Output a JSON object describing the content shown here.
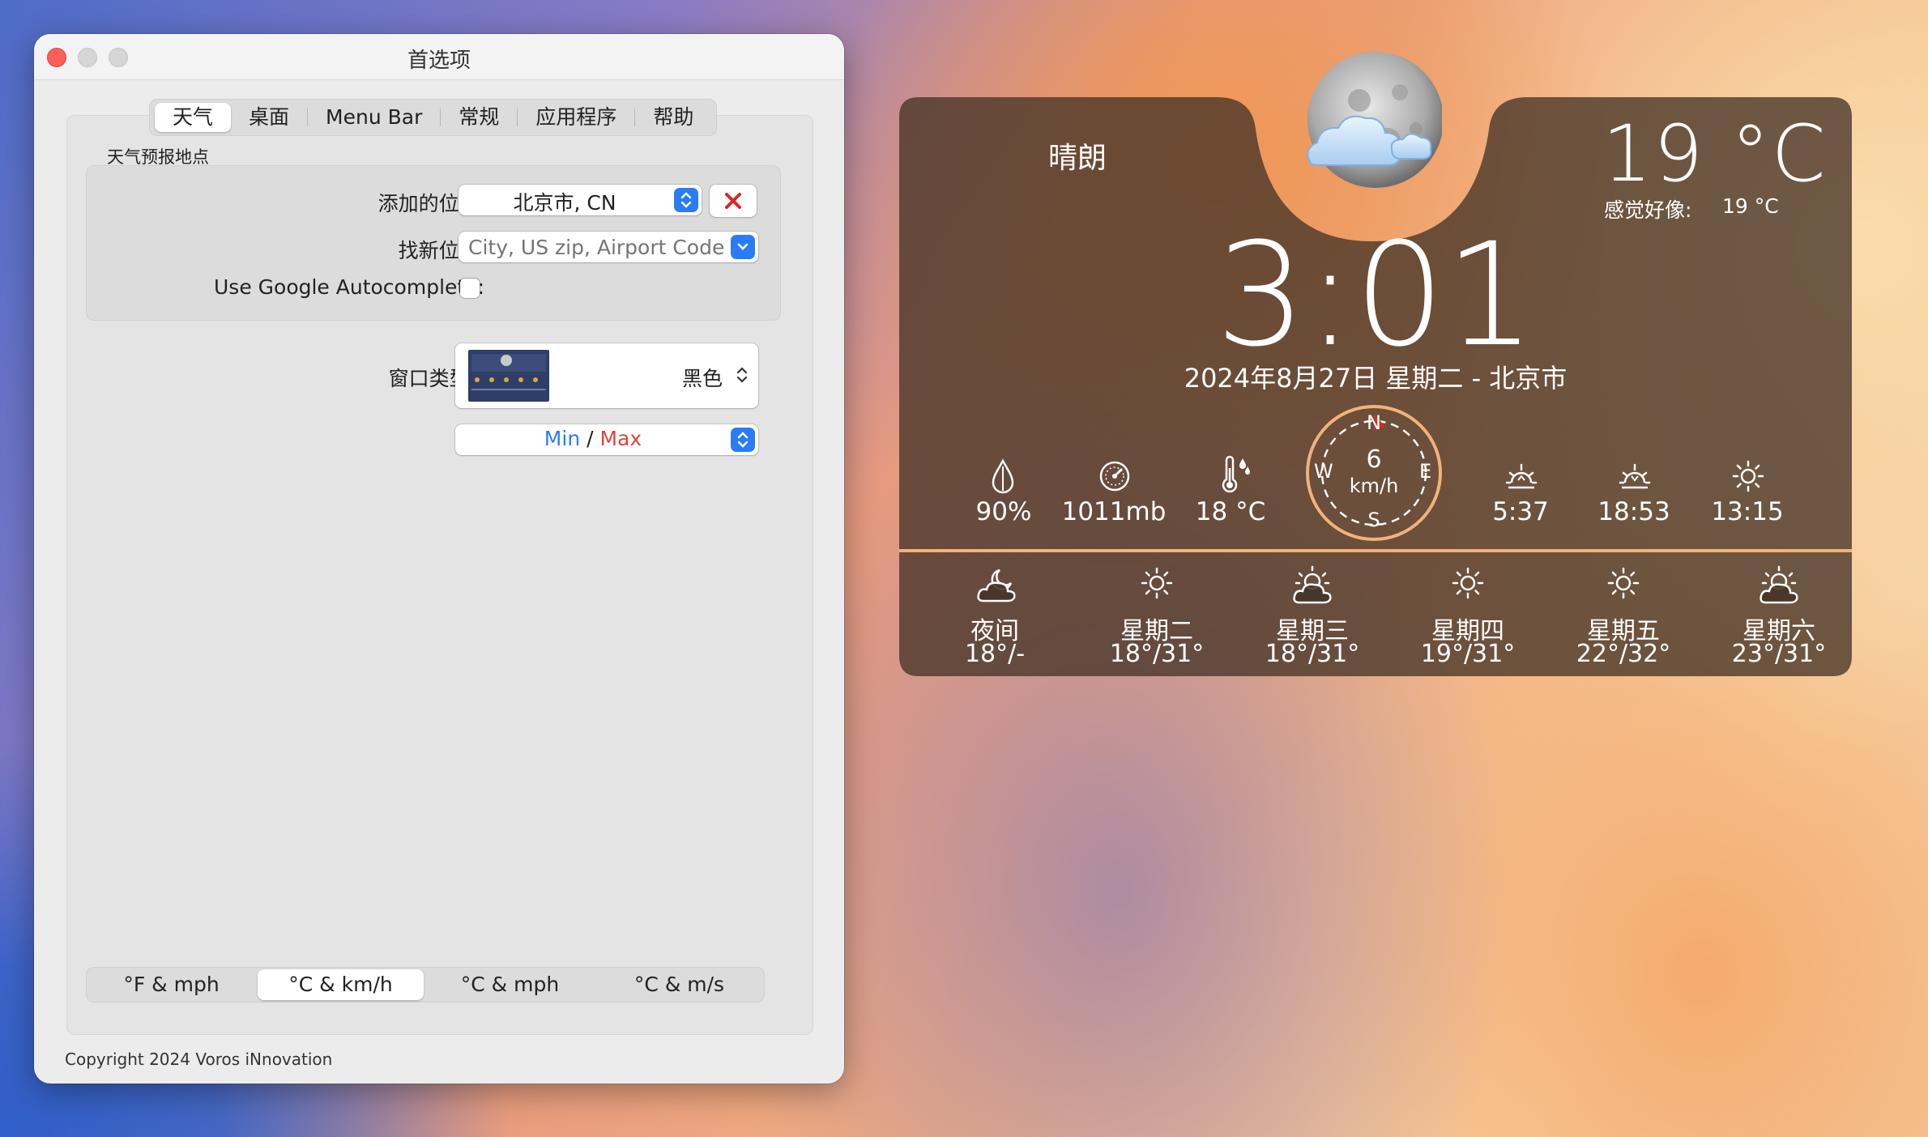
{
  "prefs": {
    "title": "首选项",
    "tabs": [
      "天气",
      "桌面",
      "Menu Bar",
      "常规",
      "应用程序",
      "帮助"
    ],
    "group_label": "天气预报地点",
    "added_location_label": "添加的位置:",
    "added_location_value": "北京市, CN",
    "find_location_label": "找新位置:",
    "find_location_placeholder": "City, US zip, Airport Code",
    "google_autocomplete_label": "Use Google Autocomplete:",
    "window_type_label": "窗口类型:",
    "window_type_value": "黑色",
    "minmax_min": "Min",
    "minmax_sep": "/",
    "minmax_max": "Max",
    "units": [
      "°F & mph",
      "°C & km/h",
      "°C & mph",
      "°C & m/s"
    ],
    "copyright": "Copyright 2024 Voros iNnovation",
    "colors": {
      "min": "#2a7cf6",
      "max": "#e0443e",
      "accent": "#2a7cf6"
    }
  },
  "weather": {
    "condition": "晴朗",
    "temperature": "19 °C",
    "feels_like_label": "感觉好像:",
    "feels_like_value": "19 °C",
    "time": "3:01",
    "date_line": "2024年8月27日 星期二 - 北京市",
    "humidity": "90%",
    "pressure": "1011mb",
    "dew_point": "18 °C",
    "wind_speed": "6",
    "wind_unit": "km/h",
    "compass": {
      "n": "N",
      "e": "E",
      "s": "S",
      "w": "W"
    },
    "sunrise": "5:37",
    "sunset": "18:53",
    "daylight": "13:15",
    "forecast": [
      {
        "day": "夜间",
        "temp": "18°/-",
        "icon": "cloudy-night-icon"
      },
      {
        "day": "星期二",
        "temp": "18°/31°",
        "icon": "sun-icon"
      },
      {
        "day": "星期三",
        "temp": "18°/31°",
        "icon": "partly-cloudy-icon"
      },
      {
        "day": "星期四",
        "temp": "19°/31°",
        "icon": "sun-icon"
      },
      {
        "day": "星期五",
        "temp": "22°/32°",
        "icon": "sun-icon"
      },
      {
        "day": "星期六",
        "temp": "23°/31°",
        "icon": "partly-cloudy-icon"
      }
    ]
  }
}
